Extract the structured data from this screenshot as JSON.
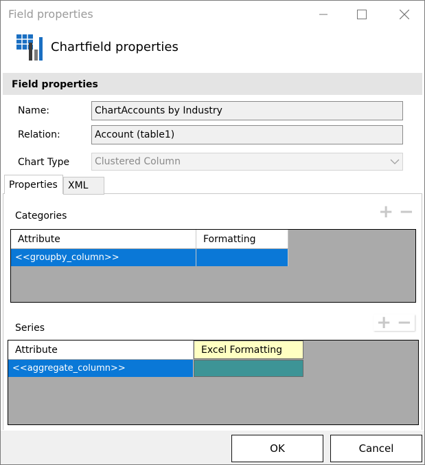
{
  "window": {
    "title": "Field properties"
  },
  "header": {
    "title": "Chartfield properties"
  },
  "section": {
    "title": "Field properties"
  },
  "fields": {
    "name_label": "Name:",
    "name_value": "ChartAccounts by Industry",
    "relation_label": "Relation:",
    "relation_value": "Account (table1)",
    "chart_type_label": "Chart Type",
    "chart_type_value": "Clustered Column"
  },
  "tabs": [
    {
      "label": "Properties",
      "active": true
    },
    {
      "label": "XML",
      "active": false
    }
  ],
  "categories": {
    "label": "Categories",
    "columns": [
      "Attribute",
      "Formatting"
    ],
    "rows": [
      [
        "<<groupby_column>>",
        ""
      ]
    ]
  },
  "series": {
    "label": "Series",
    "columns": [
      "Attribute",
      "Excel Formatting"
    ],
    "rows": [
      [
        "<<aggregate_column>>",
        ""
      ]
    ]
  },
  "buttons": {
    "ok": "OK",
    "cancel": "Cancel"
  },
  "colors": {
    "selection": "#0a78d7",
    "section_bar": "#e4e4e4",
    "grid_background": "#aaaaaa",
    "highlight_header": "#ffffc2",
    "highlight_cell": "#3d9496"
  }
}
